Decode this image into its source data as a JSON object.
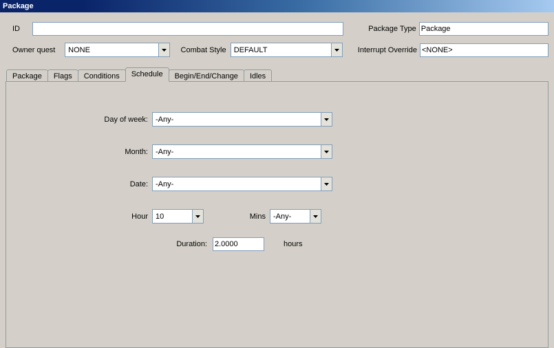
{
  "window": {
    "title": "Package"
  },
  "top": {
    "id_label": "ID",
    "id_value": "",
    "package_type_label": "Package Type",
    "package_type_value": "Package",
    "owner_quest_label": "Owner quest",
    "owner_quest_value": "NONE",
    "combat_style_label": "Combat Style",
    "combat_style_value": "DEFAULT",
    "interrupt_override_label": "Interrupt Override",
    "interrupt_override_value": "<NONE>"
  },
  "tabs": [
    {
      "label": "Package"
    },
    {
      "label": "Flags"
    },
    {
      "label": "Conditions"
    },
    {
      "label": "Schedule"
    },
    {
      "label": "Begin/End/Change"
    },
    {
      "label": "Idles"
    }
  ],
  "schedule": {
    "day_of_week_label": "Day of week:",
    "day_of_week_value": "-Any-",
    "month_label": "Month:",
    "month_value": "-Any-",
    "date_label": "Date:",
    "date_value": "-Any-",
    "hour_label": "Hour",
    "hour_value": "10",
    "mins_label": "Mins",
    "mins_value": "-Any-",
    "duration_label": "Duration:",
    "duration_value": "2.0000",
    "duration_suffix": "hours"
  }
}
